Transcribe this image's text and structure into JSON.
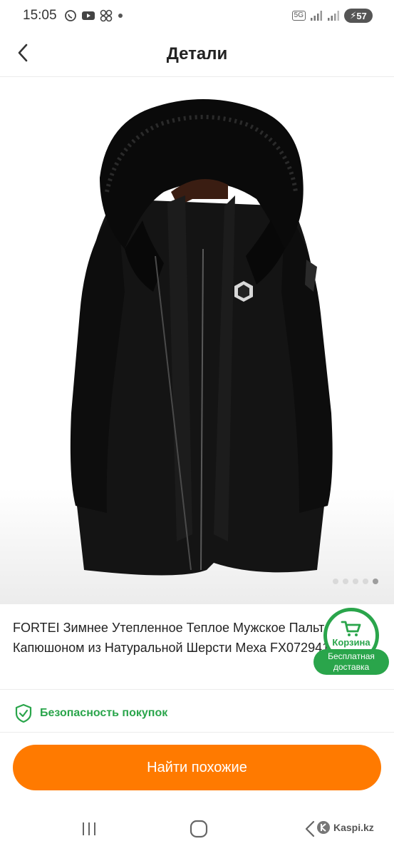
{
  "status_bar": {
    "time": "15:05",
    "network": "5G",
    "battery": "57",
    "icons": [
      "whatsapp-icon",
      "youtube-icon",
      "pinwheel-icon",
      "dot-icon",
      "signal-icon",
      "wifi-icon"
    ]
  },
  "header": {
    "title": "Детали",
    "back_icon": "chevron-left-icon"
  },
  "gallery": {
    "image_subject": "black hooded fur coat",
    "dots_count": 5,
    "active_dot": 5
  },
  "product": {
    "title": "FORTEI Зимнее Утепленное Теплое Мужское Пальто с Капюшоном из Натуральной Шерсти Меха FX07294106"
  },
  "cart": {
    "label": "Корзина",
    "ribbon_line1": "Бесплатная",
    "ribbon_line2": "доставка"
  },
  "safety": {
    "text": "Безопасность покупок"
  },
  "actions": {
    "find_similar": "Найти похожие"
  },
  "watermark": {
    "text": "Kaspi.kz"
  },
  "colors": {
    "accent_orange": "#ff7a00",
    "accent_green": "#2aa54b"
  }
}
